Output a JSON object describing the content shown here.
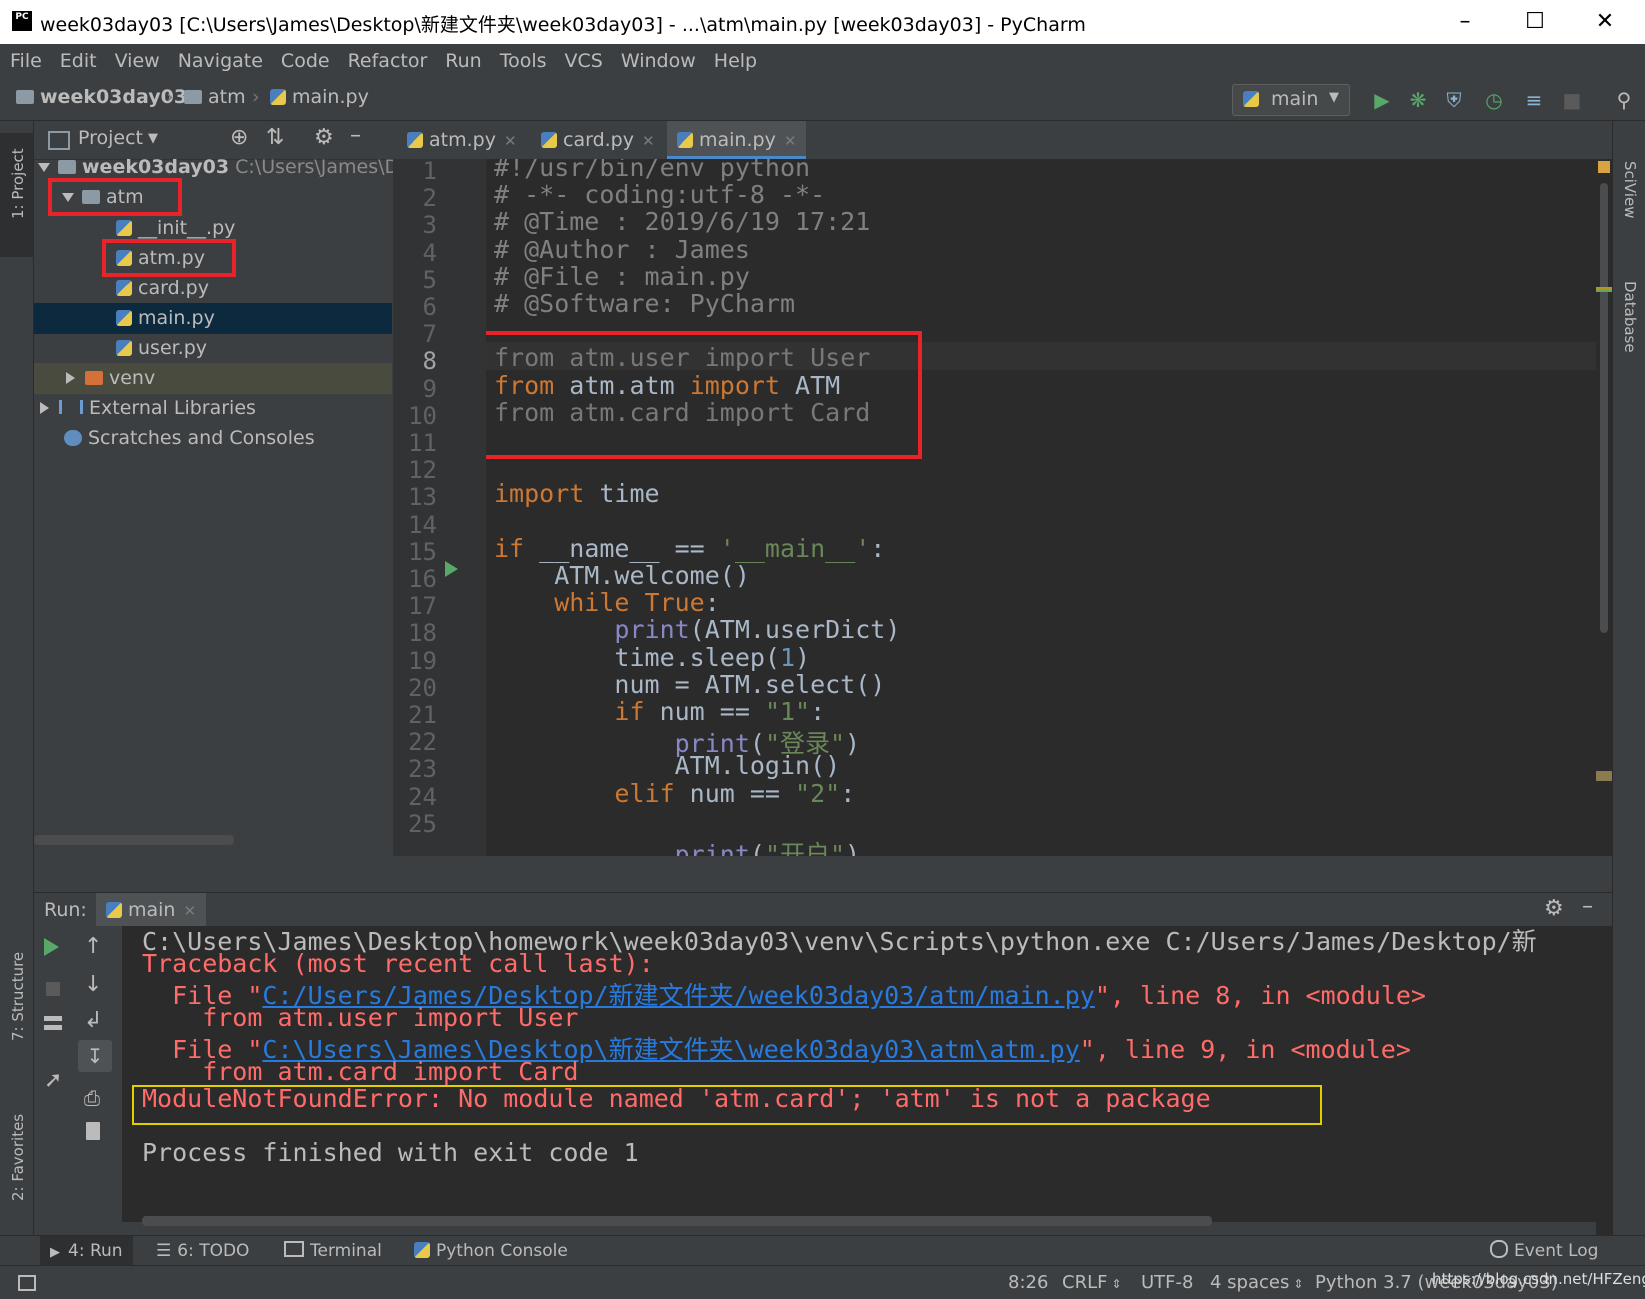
{
  "window": {
    "title": "week03day03 [C:\\Users\\James\\Desktop\\新建文件夹\\week03day03] - ...\\atm\\main.py [week03day03] - PyCharm",
    "logo": "PC"
  },
  "menu": [
    "File",
    "Edit",
    "View",
    "Navigate",
    "Code",
    "Refactor",
    "Run",
    "Tools",
    "VCS",
    "Window",
    "Help"
  ],
  "breadcrumb": [
    "week03day03",
    "atm",
    "main.py"
  ],
  "run_config": "main",
  "left_stripe": {
    "project": "1: Project",
    "structure": "7: Structure",
    "favorites": "2: Favorites"
  },
  "right_stripe": {
    "sciview": "SciView",
    "database": "Database"
  },
  "project_panel": {
    "title": "Project",
    "root": {
      "name": "week03day03",
      "path": "C:\\Users\\James\\Des"
    },
    "items": [
      "atm",
      "__init__.py",
      "atm.py",
      "card.py",
      "main.py",
      "user.py",
      "venv",
      "External Libraries",
      "Scratches and Consoles"
    ]
  },
  "tabs": [
    "atm.py",
    "card.py",
    "main.py"
  ],
  "editor": {
    "line_numbers": [
      "1",
      "2",
      "3",
      "4",
      "5",
      "6",
      "7",
      "8",
      "9",
      "10",
      "11",
      "12",
      "13",
      "14",
      "15",
      "16",
      "17",
      "18",
      "19",
      "20",
      "21",
      "22",
      "23",
      "24",
      "25"
    ],
    "lines": {
      "l1": "#!/usr/bin/env python",
      "l2": "# -*- coding:utf-8 -*-",
      "l3": "# @Time : 2019/6/19 17:21",
      "l4": "# @Author : James",
      "l5": "# @File : main.py",
      "l6": "# @Software: PyCharm",
      "l8a": "from",
      "l8b": " atm.user ",
      "l8c": "import",
      "l8d": " User",
      "l9a": "from",
      "l9b": " atm.atm ",
      "l9c": "import",
      "l9d": " ATM",
      "l10a": "from",
      "l10b": " atm.card ",
      "l10c": "import",
      "l10d": " Card",
      "l13a": "import",
      "l13b": " time",
      "l15a": "if",
      "l15b": " __name__ == ",
      "l15c": "'__main__'",
      "l15d": ":",
      "l16": "    ATM.welcome()",
      "l17a": "    while",
      "l17b": " True",
      "l17c": ":",
      "l18a": "        print",
      "l18b": "(ATM.userDict)",
      "l19a": "        time.sleep(",
      "l19b": "1",
      "l19c": ")",
      "l20": "        num = ATM.select()",
      "l21a": "        if",
      "l21b": " num == ",
      "l21c": "\"1\"",
      "l21d": ":",
      "l22a": "            print",
      "l22b": "(",
      "l22c": "\"登录\"",
      "l22d": ")",
      "l23": "            ATM.login()",
      "l24a": "        elif",
      "l24b": " num == ",
      "l24c": "\"2\"",
      "l24d": ":",
      "l25a": "            print",
      "l25b": "(",
      "l25c": "\"开户\"",
      "l25d": ")"
    }
  },
  "run_panel": {
    "label": "Run:",
    "tab": "main",
    "output": {
      "o1": "C:\\Users\\James\\Desktop\\homework\\week03day03\\venv\\Scripts\\python.exe C:/Users/James/Desktop/新",
      "o2": "Traceback (most recent call last):",
      "o3a": "  File \"",
      "o3b": "C:/Users/James/Desktop/新建文件夹/week03day03/atm/main.py",
      "o3c": "\", line 8, in <module>",
      "o4": "    from atm.user import User",
      "o5a": "  File \"",
      "o5b": "C:\\Users\\James\\Desktop\\新建文件夹\\week03day03\\atm\\atm.py",
      "o5c": "\", line 9, in <module>",
      "o6": "    from atm.card import Card",
      "o7": "ModuleNotFoundError: No module named 'atm.card'; 'atm' is not a package",
      "o8": "Process finished with exit code 1"
    }
  },
  "bottom_tabs": {
    "run": "4: Run",
    "todo": "6: TODO",
    "terminal": "Terminal",
    "console": "Python Console",
    "event_log": "Event Log"
  },
  "status": {
    "position": "8:26",
    "line_sep": "CRLF",
    "encoding": "UTF-8",
    "indent": "4 spaces",
    "interpreter": "Python 3.7 (week03day03)",
    "watermark": "https://blog.csdn.net/HFZeng"
  },
  "colors": {
    "highlight_box": "#e8242a",
    "error_box": "#e0d000",
    "error_text": "#ff6b68",
    "link": "#287bde",
    "selection": "#0d293e"
  }
}
